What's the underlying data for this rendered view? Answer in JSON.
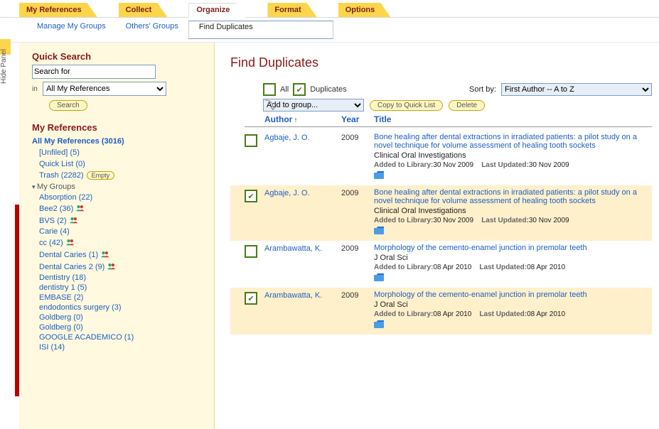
{
  "hidepanel": "Hide Panel",
  "tabs": {
    "refs": "My References",
    "collect": "Collect",
    "organize": "Organize",
    "format": "Format",
    "options": "Options"
  },
  "subnav": {
    "groups": "Manage My Groups",
    "others": "Others' Groups",
    "dup": "Find Duplicates"
  },
  "qs": {
    "title": "Quick Search",
    "placeholder": "Search for",
    "in_label": "in",
    "in_value": "All My References",
    "search_btn": "Search"
  },
  "mr": {
    "title": "My References",
    "all": "All My References (3016)",
    "unfiled": "[Unfiled] (5)",
    "quicklist": "Quick List (0)",
    "trash": "Trash (2282)",
    "empty": "Empty",
    "groups_head": "My Groups",
    "groups": [
      {
        "label": "Absorption (22)",
        "share": false
      },
      {
        "label": "Bee2 (36)",
        "share": true
      },
      {
        "label": "BVS (2)",
        "share": true
      },
      {
        "label": "Carie (4)",
        "share": false
      },
      {
        "label": "cc (42)",
        "share": true
      },
      {
        "label": "Dental Caries (1)",
        "share": true
      },
      {
        "label": "Dental Caries 2 (9)",
        "share": true
      },
      {
        "label": "Dentistry (18)",
        "share": false
      },
      {
        "label": "dentistry 1 (5)",
        "share": false
      },
      {
        "label": "EMBASE (2)",
        "share": false
      },
      {
        "label": "endodontics surgery (3)",
        "share": false
      },
      {
        "label": "Goldberg (0)",
        "share": false
      },
      {
        "label": "Goldberg (0)",
        "share": false
      },
      {
        "label": "GOOGLE ACADEMICO (1)",
        "share": false
      },
      {
        "label": "ISI (14)",
        "share": false
      }
    ]
  },
  "main": {
    "title": "Find Duplicates",
    "all": "All",
    "dup": "Duplicates",
    "sortlabel": "Sort by:",
    "sortval": "First Author -- A to Z",
    "addgroup": "Add to group...",
    "copy": "Copy to Quick List",
    "delete": "Delete",
    "h_author": "Author",
    "h_year": "Year",
    "h_title": "Title",
    "added_lbl": "Added to Library:",
    "upd_lbl": "Last Updated:",
    "rows": [
      {
        "chk": false,
        "author": "Agbaje, J. O.",
        "year": "2009",
        "title": "Bone healing after dental extractions in irradiated patients: a pilot study on a novel technique for volume assessment of healing tooth sockets",
        "journal": "Clinical Oral Investigations",
        "added": "30 Nov 2009",
        "upd": "30 Nov 2009",
        "dup": false
      },
      {
        "chk": true,
        "author": "Agbaje, J. O.",
        "year": "2009",
        "title": "Bone healing after dental extractions in irradiated patients: a pilot study on a novel technique for volume assessment of healing tooth sockets",
        "journal": "Clinical Oral Investigations",
        "added": "30 Nov 2009",
        "upd": "30 Nov 2009",
        "dup": true
      },
      {
        "chk": false,
        "author": "Arambawatta, K.",
        "year": "2009",
        "title": "Morphology of the cemento-enamel junction in premolar teeth",
        "journal": "J Oral Sci",
        "added": "08 Apr 2010",
        "upd": "08 Apr 2010",
        "dup": false
      },
      {
        "chk": true,
        "author": "Arambawatta, K.",
        "year": "2009",
        "title": "Morphology of the cemento-enamel junction in premolar teeth",
        "journal": "J Oral Sci",
        "added": "08 Apr 2010",
        "upd": "08 Apr 2010",
        "dup": true
      }
    ]
  }
}
